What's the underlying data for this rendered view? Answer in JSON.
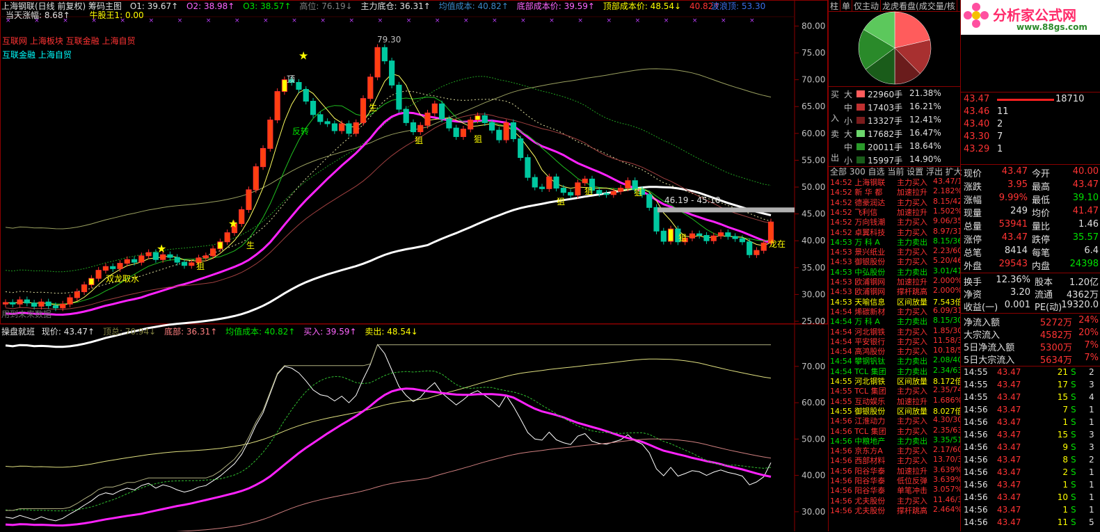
{
  "header": {
    "title": "上海钢联(日线 前复权) 筹码主图",
    "o1": "O1: 39.67↑",
    "o2": "O2: 38.98↑",
    "o3": "O3: 38.57↑",
    "high": "高位: 76.19↓",
    "main_bottom": "主力底仓: 36.31↑",
    "avg_cost": "均值成本: 40.82↑",
    "bottom_cost": "底部成本价: 39.59↑",
    "top_cost": "顶部成本价: 48.54↓",
    "extra": "40.82↑",
    "wave_top": "波浪顶: 53.30",
    "day_rise": "当天涨幅: 8.68↑",
    "bull_king": "牛股王1: 0.00"
  },
  "sector_tags": {
    "line1": "互联网 上海板块 互联金融 上海自贸",
    "line2": "互联金融 上海自贸"
  },
  "annotations": {
    "peak_price": "79.30",
    "range_label": "46.19 - 45.10",
    "top": "顶",
    "reverse": "反转",
    "sheng": "生",
    "ju": "狙",
    "double_dragon": "双龙取水",
    "dragon_in": "龙在",
    "bottom_hint": "用到未来数据"
  },
  "y_axis_top": [
    "80.00",
    "75.00",
    "70.00",
    "65.00",
    "60.00",
    "55.00",
    "50.00",
    "45.00",
    "40.00",
    "35.00",
    "30.00",
    "25.00"
  ],
  "y_axis_bottom": [
    "70.00",
    "60.00",
    "50.00",
    "40.00",
    "30.00"
  ],
  "sub_header": {
    "name": "操盘就班",
    "price": "现价: 43.47↑",
    "top_total": "顶总: 70.94↓",
    "bottom": "底部: 36.31↑",
    "avg": "均值成本: 40.82↑",
    "buy": "买入: 39.59↑",
    "sell": "卖出: 48.54↓"
  },
  "side_tabs": [
    "柱",
    "单",
    "仅主动",
    "龙虎看盘(成交量/核"
  ],
  "flow": {
    "buy_label": [
      "买",
      "入"
    ],
    "sell_label": [
      "卖",
      "出"
    ],
    "rows": [
      {
        "size": "大",
        "vol": "22960手",
        "pct": "21.38%",
        "color": "#ff5c5c"
      },
      {
        "size": "中",
        "vol": "17403手",
        "pct": "16.21%",
        "color": "#c03030"
      },
      {
        "size": "小",
        "vol": "13327手",
        "pct": "12.41%",
        "color": "#7a1c1c"
      },
      {
        "size": "大",
        "vol": "17682手",
        "pct": "16.47%",
        "color": "#6cd66c"
      },
      {
        "size": "中",
        "vol": "20011手",
        "pct": "18.64%",
        "color": "#2a9a2a"
      },
      {
        "size": "小",
        "vol": "15997手",
        "pct": "14.90%",
        "color": "#1a5c1a"
      }
    ]
  },
  "pie": [
    {
      "label": "大买",
      "value": 21.38,
      "color": "#ff5c5c"
    },
    {
      "label": "中买",
      "value": 16.21,
      "color": "#a83030"
    },
    {
      "label": "小买",
      "value": 12.41,
      "color": "#6a1c1c"
    },
    {
      "label": "小卖",
      "value": 14.9,
      "color": "#1a5c1a"
    },
    {
      "label": "中卖",
      "value": 18.64,
      "color": "#2a8a2a"
    },
    {
      "label": "大卖",
      "value": 16.47,
      "color": "#5cc85c"
    }
  ],
  "list_tabs": "全部  300  自选  当前  设置  浮出  扩大",
  "ticker_rows": [
    {
      "t": "14:52",
      "n": "上海钢联",
      "a": "主力买入",
      "v": "43.47/1",
      "c": "red"
    },
    {
      "t": "14:52",
      "n": "新 华 都",
      "a": "加速拉升",
      "v": "2.182%",
      "c": "red"
    },
    {
      "t": "14:52",
      "n": "德豪润达",
      "a": "主力买入",
      "v": "8.15/42",
      "c": "red"
    },
    {
      "t": "14:52",
      "n": "飞利信",
      "a": "加速拉升",
      "v": "1.502%",
      "c": "red"
    },
    {
      "t": "14:52",
      "n": "万向钱潮",
      "a": "主力买入",
      "v": "9.06/35",
      "c": "red"
    },
    {
      "t": "14:52",
      "n": "卓翼科技",
      "a": "主力买入",
      "v": "8.97/31",
      "c": "red"
    },
    {
      "t": "14:53",
      "n": "万 科 A",
      "a": "主力卖出",
      "v": "8.15/36",
      "c": "grn"
    },
    {
      "t": "14:53",
      "n": "景兴纸业",
      "a": "主力买入",
      "v": "2.23/60",
      "c": "red"
    },
    {
      "t": "14:53",
      "n": "御银股份",
      "a": "主力买入",
      "v": "5.20/46",
      "c": "red"
    },
    {
      "t": "14:53",
      "n": "中弘股份",
      "a": "主力卖出",
      "v": "3.01/41",
      "c": "grn"
    },
    {
      "t": "14:53",
      "n": "欧浦钢网",
      "a": "加速拉升",
      "v": "2.000%",
      "c": "red"
    },
    {
      "t": "14:53",
      "n": "欧浦钢网",
      "a": "撑杆跳高",
      "v": "2.000%",
      "c": "red"
    },
    {
      "t": "14:53",
      "n": "天喻信息",
      "a": "区间放量",
      "v": "7.543倍",
      "c": "yel"
    },
    {
      "t": "14:54",
      "n": "烯碳新材",
      "a": "主力买入",
      "v": "6.09/31",
      "c": "red"
    },
    {
      "t": "14:54",
      "n": "万 科 A",
      "a": "主力卖出",
      "v": "8.15/30",
      "c": "grn"
    },
    {
      "t": "14:54",
      "n": "河北钢铁",
      "a": "主力买入",
      "v": "1.85/30",
      "c": "red"
    },
    {
      "t": "14:54",
      "n": "平安银行",
      "a": "主力买入",
      "v": "11.58/3",
      "c": "red"
    },
    {
      "t": "14:54",
      "n": "高鸿股份",
      "a": "主力买入",
      "v": "10.18/5",
      "c": "red"
    },
    {
      "t": "14:54",
      "n": "攀钢钒钛",
      "a": "主力卖出",
      "v": "2.08/40",
      "c": "grn"
    },
    {
      "t": "14:54",
      "n": "TCL 集团",
      "a": "主力卖出",
      "v": "2.34/63",
      "c": "grn"
    },
    {
      "t": "14:55",
      "n": "河北钢铁",
      "a": "区间放量",
      "v": "8.172倍",
      "c": "yel"
    },
    {
      "t": "14:55",
      "n": "TCL 集团",
      "a": "主力买入",
      "v": "2.35/74",
      "c": "red"
    },
    {
      "t": "14:55",
      "n": "互动娱乐",
      "a": "加速拉升",
      "v": "1.686%",
      "c": "red"
    },
    {
      "t": "14:55",
      "n": "御银股份",
      "a": "区间放量",
      "v": "8.027倍",
      "c": "yel"
    },
    {
      "t": "14:56",
      "n": "江淮动力",
      "a": "主力买入",
      "v": "4.30/30",
      "c": "red"
    },
    {
      "t": "14:56",
      "n": "TCL 集团",
      "a": "主力买入",
      "v": "2.35/63",
      "c": "red"
    },
    {
      "t": "14:56",
      "n": "中粮地产",
      "a": "主力卖出",
      "v": "3.35/51",
      "c": "grn"
    },
    {
      "t": "14:56",
      "n": "京东方A",
      "a": "主力买入",
      "v": "2.17/60",
      "c": "red"
    },
    {
      "t": "14:56",
      "n": "西部材料",
      "a": "主力买入",
      "v": "13.70/3",
      "c": "red"
    },
    {
      "t": "14:56",
      "n": "阳谷华泰",
      "a": "加速拉升",
      "v": "3.639%",
      "c": "red"
    },
    {
      "t": "14:56",
      "n": "阳谷华泰",
      "a": "低位反弹",
      "v": "3.639%",
      "c": "red"
    },
    {
      "t": "14:56",
      "n": "阳谷华泰",
      "a": "单笔冲击",
      "v": "3.057%",
      "c": "red"
    },
    {
      "t": "14:56",
      "n": "尤夫股份",
      "a": "主力买入",
      "v": "11.46/3",
      "c": "red"
    },
    {
      "t": "14:56",
      "n": "尤夫股份",
      "a": "撑杆跳高",
      "v": "2.464%",
      "c": "red"
    }
  ],
  "brand": {
    "name": "分析家公式网",
    "url": "www.88gs.com"
  },
  "order_book": [
    {
      "price": "43.47",
      "vol": "18710"
    },
    {
      "price": "43.46",
      "vol": "11"
    },
    {
      "price": "43.40",
      "vol": "2"
    },
    {
      "price": "43.30",
      "vol": "7"
    },
    {
      "price": "43.29",
      "vol": "1"
    }
  ],
  "quote": [
    {
      "l1": "现价",
      "v1": "43.47",
      "l2": "今开",
      "v2": "40.00"
    },
    {
      "l1": "涨跌",
      "v1": "3.95",
      "l2": "最高",
      "v2": "43.47"
    },
    {
      "l1": "涨幅",
      "v1": "9.99%",
      "l2": "最低",
      "v2": "39.10"
    },
    {
      "l1": "现量",
      "v1": "249",
      "l2": "均价",
      "v2": "41.47"
    },
    {
      "l1": "总量",
      "v1": "53941",
      "l2": "量比",
      "v2": "1.46"
    },
    {
      "l1": "涨停",
      "v1": "43.47",
      "l2": "跌停",
      "v2": "35.57"
    },
    {
      "l1": "总笔",
      "v1": "8414",
      "l2": "每笔",
      "v2": "6.4"
    },
    {
      "l1": "外盘",
      "v1": "29543",
      "l2": "内盘",
      "v2": "24398"
    }
  ],
  "stats": [
    {
      "l1": "换手",
      "v1": "12.36%",
      "l2": "股本",
      "v2": "1.20亿"
    },
    {
      "l1": "净资",
      "v1": "3.20",
      "l2": "流通",
      "v2": "4362万"
    },
    {
      "l1": "收益(一)",
      "v1": "0.001",
      "l2": "PE(动)",
      "v2": "19320.0"
    }
  ],
  "fund_flow": [
    {
      "l": "净流入额",
      "v": "5272万",
      "p": "24%"
    },
    {
      "l": "大宗流入",
      "v": "4582万",
      "p": "20%"
    },
    {
      "l": "5日净流入额",
      "v": "5300万",
      "p": "7%"
    },
    {
      "l": "5日大宗流入",
      "v": "5634万",
      "p": "7%"
    }
  ],
  "trades": [
    {
      "t": "14:55",
      "p": "43.47",
      "v": "21",
      "s": "S",
      "n": "2"
    },
    {
      "t": "14:55",
      "p": "43.47",
      "v": "17",
      "s": "S",
      "n": "3"
    },
    {
      "t": "14:55",
      "p": "43.47",
      "v": "15",
      "s": "S",
      "n": "4"
    },
    {
      "t": "14:56",
      "p": "43.47",
      "v": "7",
      "s": "S",
      "n": "1"
    },
    {
      "t": "14:56",
      "p": "43.47",
      "v": "1",
      "s": "S",
      "n": "1"
    },
    {
      "t": "14:56",
      "p": "43.47",
      "v": "15",
      "s": "S",
      "n": "3"
    },
    {
      "t": "14:56",
      "p": "43.47",
      "v": "9",
      "s": "S",
      "n": "3"
    },
    {
      "t": "14:56",
      "p": "43.47",
      "v": "8",
      "s": "S",
      "n": "2"
    },
    {
      "t": "14:56",
      "p": "43.47",
      "v": "2",
      "s": "S",
      "n": "1"
    },
    {
      "t": "14:56",
      "p": "43.47",
      "v": "1",
      "s": "S",
      "n": "1"
    },
    {
      "t": "14:56",
      "p": "43.47",
      "v": "10",
      "s": "S",
      "n": "1"
    },
    {
      "t": "14:56",
      "p": "43.47",
      "v": "1",
      "s": "S",
      "n": "1"
    },
    {
      "t": "14:56",
      "p": "43.47",
      "v": "11",
      "s": "S",
      "n": "5"
    }
  ],
  "chart_data": {
    "type": "candlestick",
    "top_panel": {
      "ylim": [
        25,
        82
      ],
      "ticks": [
        80,
        75,
        70,
        65,
        60,
        55,
        50,
        45,
        40,
        35,
        30,
        25
      ]
    },
    "bottom_panel": {
      "ylim": [
        25,
        78
      ],
      "ticks": [
        70,
        60,
        50,
        40,
        30
      ]
    },
    "closes": [
      28.5,
      28.2,
      29.0,
      28.4,
      27.8,
      28.6,
      27.9,
      27.5,
      28.2,
      29.4,
      30.5,
      31.8,
      33.0,
      34.5,
      35.2,
      34.8,
      35.8,
      36.5,
      36.0,
      37.2,
      37.8,
      36.5,
      37.4,
      36.9,
      36.0,
      35.4,
      35.9,
      36.8,
      37.2,
      38.5,
      39.8,
      41.5,
      43.2,
      45.8,
      49.5,
      53.8,
      57.2,
      62.5,
      67.8,
      70.0,
      69.5,
      68.2,
      66.0,
      63.5,
      62.2,
      61.8,
      60.5,
      61.8,
      60.0,
      62.0,
      66.5,
      70.5,
      76.0,
      73.5,
      69.0,
      64.5,
      62.0,
      60.3,
      61.5,
      63.8,
      65.5,
      62.7,
      61.0,
      59.4,
      60.8,
      62.5,
      63.3,
      62.0,
      60.6,
      58.8,
      62.0,
      59.0,
      55.5,
      51.8,
      50.0,
      49.7,
      51.9,
      49.8,
      49.0,
      48.5,
      50.8,
      51.5,
      49.4,
      48.8,
      48.6,
      49.2,
      49.8,
      51.2,
      49.5,
      48.6,
      46.2,
      41.8,
      39.9,
      42.2,
      39.8,
      40.5,
      41.3,
      41.0,
      40.0,
      40.9,
      41.5,
      40.8,
      40.4,
      39.8,
      37.4,
      38.2,
      39.6,
      43.5
    ]
  }
}
